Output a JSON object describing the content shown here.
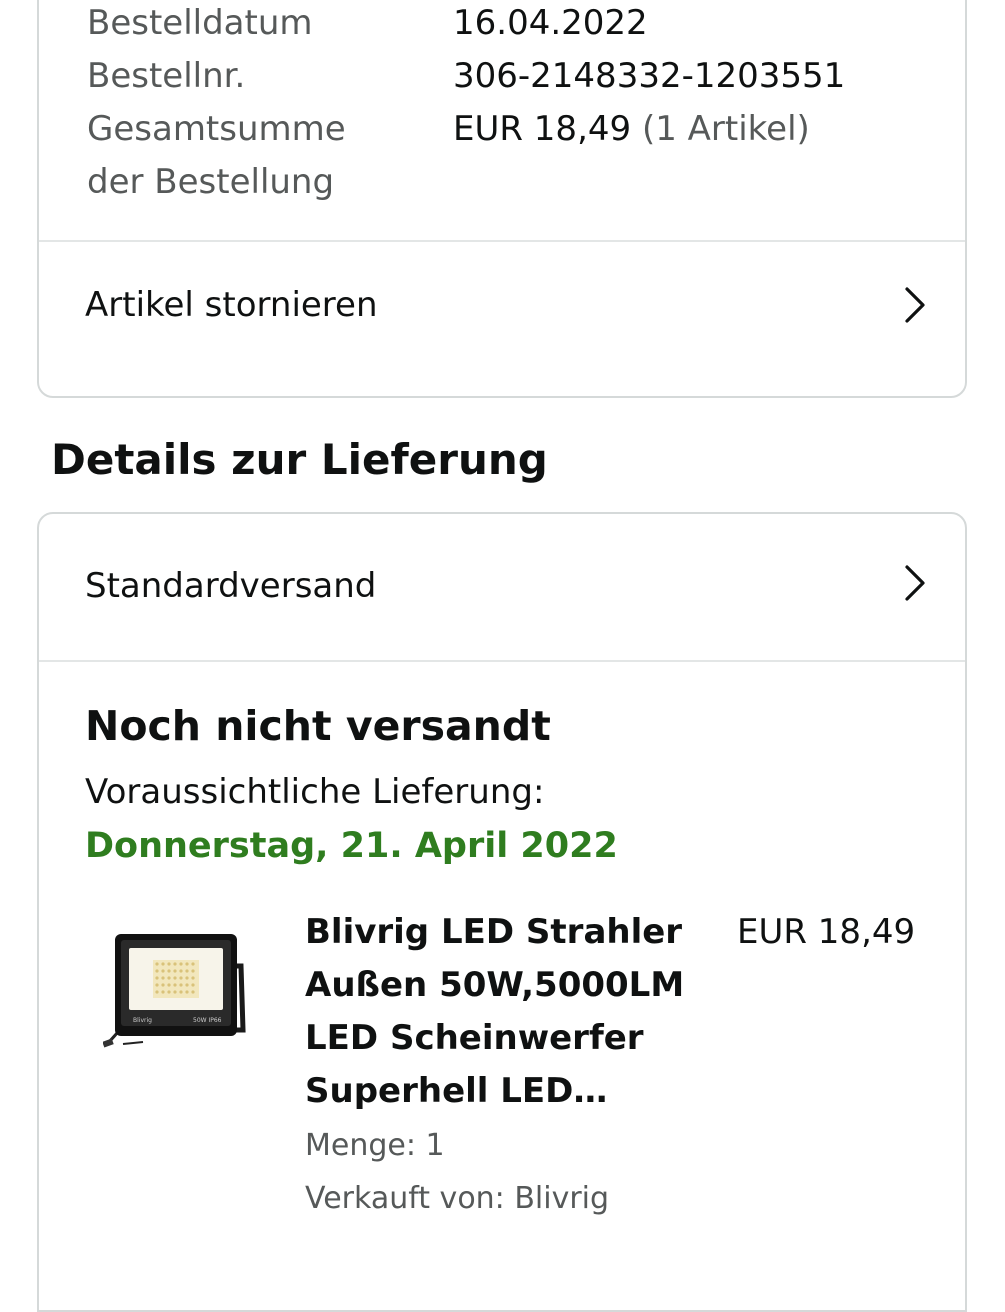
{
  "order_summary": {
    "rows": [
      {
        "label": "Bestelldatum",
        "value": "16.04.2022"
      },
      {
        "label": "Bestellnr.",
        "value": "306-2148332-1203551"
      }
    ],
    "total_label_line1": "Gesamtsumme",
    "total_label_line2": "der Bestellung",
    "total_value": "EUR 18,49",
    "total_items": "(1 Artikel)",
    "cancel_label": "Artikel stornieren"
  },
  "delivery": {
    "section_title": "Details zur Lieferung",
    "shipping_method": "Standardversand",
    "status": "Noch nicht versandt",
    "eta_label": "Voraussichtliche Lieferung:",
    "eta_date": "Donnerstag, 21. April 2022",
    "eta_color": "#2f7d1f"
  },
  "item": {
    "title": "Blivrig LED Strahler Außen 50W,5000LM LED Scheinwerfer Superhell LED…",
    "price": "EUR 18,49",
    "quantity": "Menge: 1",
    "seller": "Verkauft von: Blivrig",
    "image_brand": "Blivrig",
    "image_spec": "50W IP66",
    "image_icon": "floodlight-product-image"
  },
  "icons": {
    "chevron": "chevron-right-icon"
  }
}
